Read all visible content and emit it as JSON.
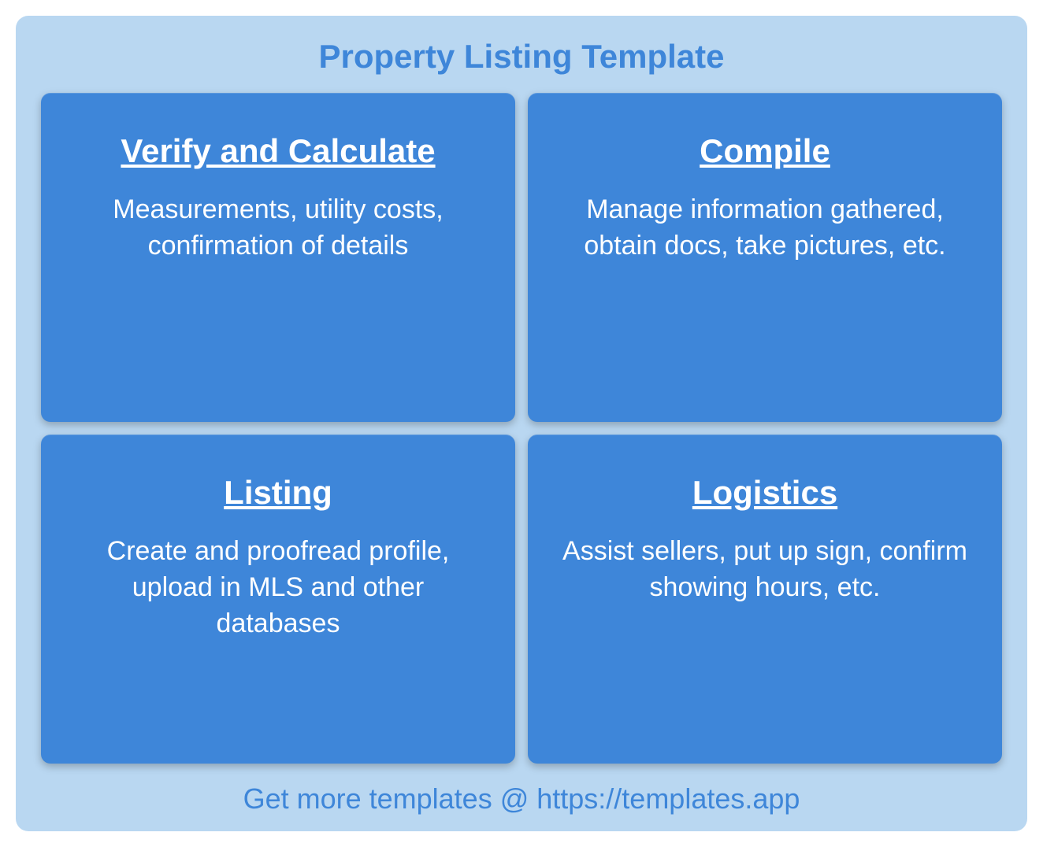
{
  "title": "Property Listing Template",
  "cards": [
    {
      "title": "Verify and Calculate",
      "desc": "Measurements, utility costs, confirmation of details"
    },
    {
      "title": "Compile",
      "desc": "Manage information gathered, obtain docs, take pictures, etc."
    },
    {
      "title": "Listing",
      "desc": "Create and proofread profile, upload in MLS and other databases"
    },
    {
      "title": "Logistics",
      "desc": "Assist sellers, put up sign, confirm showing hours, etc."
    }
  ],
  "footer": "Get more templates @ https://templates.app"
}
